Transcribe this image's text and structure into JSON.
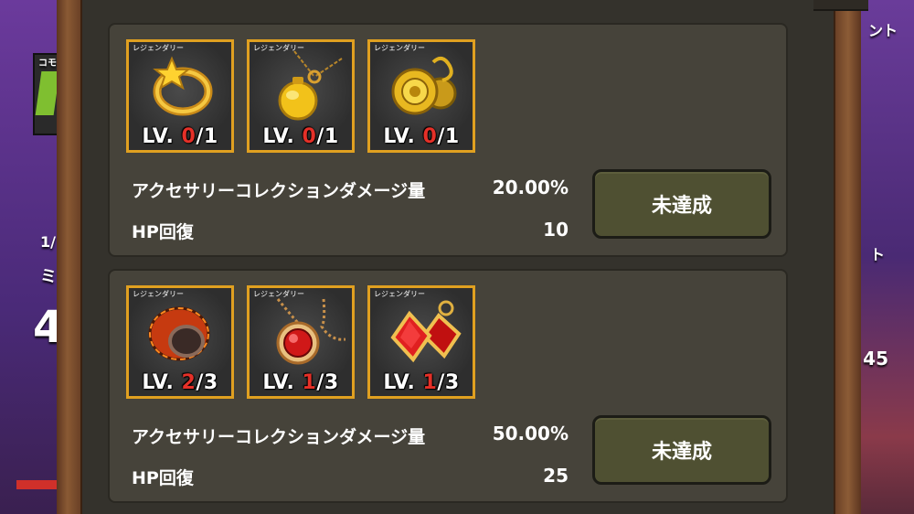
{
  "background": {
    "left_fragments": [
      "コモ",
      "1/",
      "ミ",
      "4"
    ],
    "right_fragments": [
      "ント",
      "ト",
      "45"
    ]
  },
  "collections": [
    {
      "items": [
        {
          "grade": "レジェンダリー",
          "icon": "star-ring-icon",
          "level": "0",
          "max": "/1",
          "prefix": "LV. "
        },
        {
          "grade": "レジェンダリー",
          "icon": "gold-pendant-necklace-icon",
          "level": "0",
          "max": "/1",
          "prefix": "LV. "
        },
        {
          "grade": "レジェンダリー",
          "icon": "gold-sun-earrings-icon",
          "level": "0",
          "max": "/1",
          "prefix": "LV. "
        }
      ],
      "stats": [
        {
          "label": "アクセサリーコレクションダメージ量",
          "value": "20.00%"
        },
        {
          "label": "HP回復",
          "value": "10"
        }
      ],
      "status_button": "未達成"
    },
    {
      "items": [
        {
          "grade": "レジェンダリー",
          "icon": "lava-ring-icon",
          "level": "2",
          "max": "/3",
          "prefix": "LV. "
        },
        {
          "grade": "レジェンダリー",
          "icon": "ruby-necklace-icon",
          "level": "1",
          "max": "/3",
          "prefix": "LV. "
        },
        {
          "grade": "レジェンダリー",
          "icon": "ruby-earrings-icon",
          "level": "1",
          "max": "/3",
          "prefix": "LV. "
        }
      ],
      "stats": [
        {
          "label": "アクセサリーコレクションダメージ量",
          "value": "50.00%"
        },
        {
          "label": "HP回復",
          "value": "25"
        }
      ],
      "status_button": "未達成"
    }
  ],
  "colors": {
    "frame_gold": "#e0a020",
    "level_current": "#e53028",
    "button_bg": "#4f5032",
    "card_bg": "#46433a"
  }
}
